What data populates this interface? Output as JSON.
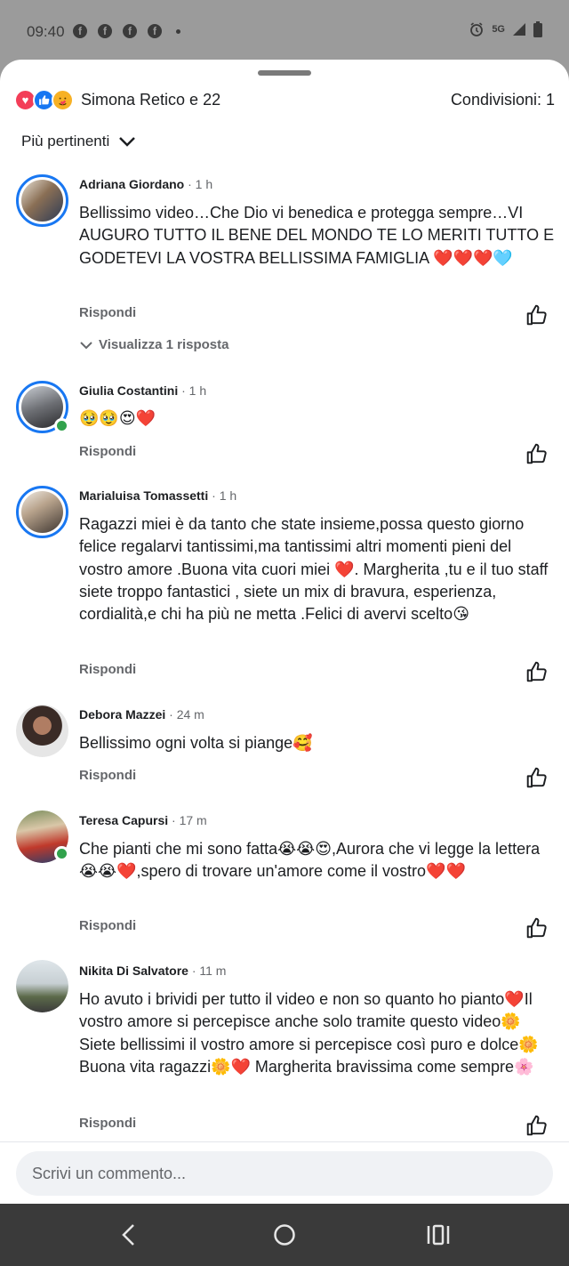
{
  "status_bar": {
    "time": "09:40",
    "notification_icons": [
      "facebook-icon",
      "facebook-icon",
      "facebook-icon",
      "facebook-icon"
    ],
    "network": "5G",
    "fb_glyph": "f"
  },
  "header": {
    "reactions": [
      "love",
      "like",
      "care"
    ],
    "reactions_label": "Simona Retico e 22",
    "shares_label": "Condivisioni: 1"
  },
  "sort": {
    "label": "Più pertinenti"
  },
  "comments": [
    {
      "name": "Adriana Giordano",
      "time": " · 1 h",
      "text": "Bellissimo video…Che Dio vi benedica e protegga sempre…VI AUGURO TUTTO IL BENE DEL MONDO TE LO MERITI TUTTO E GODETEVI LA VOSTRA BELLISSIMA FAMIGLIA ❤️❤️❤️🩵",
      "reply": "Rispondi",
      "view_replies": "Visualizza 1 risposta"
    },
    {
      "name": "Giulia Costantini",
      "time": " · 1 h",
      "text": "🥹🥹😍❤️",
      "reply": "Rispondi"
    },
    {
      "name": "Marialuisa Tomassetti",
      "time": " · 1 h",
      "text": "Ragazzi miei è da tanto che state insieme,possa questo giorno felice regalarvi tantissimi,ma tantissimi altri momenti pieni del vostro amore .Buona vita cuori miei ❤️. Margherita ,tu e il tuo staff siete troppo fantastici , siete un mix di bravura, esperienza, cordialità,e chi ha più ne metta .Felici di avervi scelto😘",
      "reply": "Rispondi"
    },
    {
      "name": "Debora Mazzei",
      "time": " · 24 m",
      "text": "Bellissimo ogni volta si piange🥰",
      "reply": "Rispondi"
    },
    {
      "name": "Teresa Capursi",
      "time": " · 17 m",
      "text": "Che pianti che mi sono fatta😭😭😍,Aurora che vi legge la lettera😭😭❤️,spero di trovare un'amore come il vostro❤️❤️",
      "reply": "Rispondi"
    },
    {
      "name": "Nikita Di Salvatore",
      "time": " · 11 m",
      "text": "Ho avuto i brividi per tutto il video e non so quanto ho pianto❤️Il vostro amore si percepisce anche solo tramite questo video🌼Siete bellissimi  il vostro amore si percepisce così puro e dolce🌼Buona vita ragazzi🌼❤️ Margherita bravissima come sempre🌸",
      "reply": "Rispondi"
    }
  ],
  "composer": {
    "placeholder": "Scrivi un commento..."
  },
  "nav": {
    "icons": [
      "back-icon",
      "home-icon",
      "recents-icon"
    ]
  },
  "colors": {
    "accent": "#1877f2",
    "online": "#31a24c",
    "love": "#f33e58",
    "care": "#f7b125"
  }
}
